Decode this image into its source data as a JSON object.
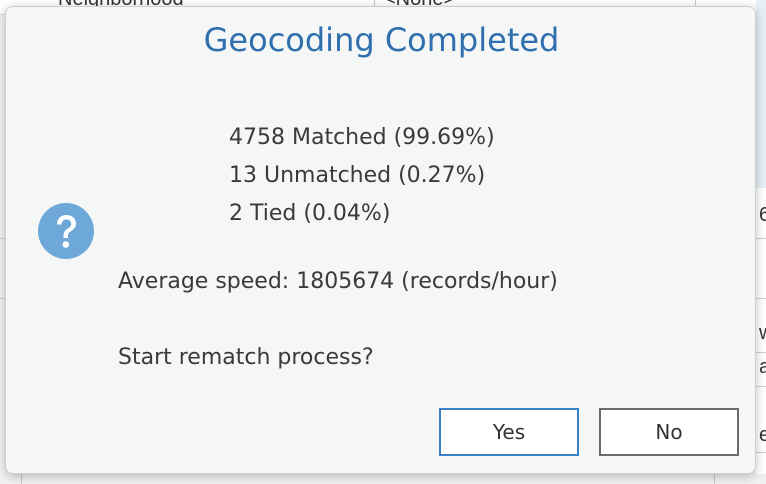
{
  "background": {
    "top_row_left_text": "Neighborhood",
    "top_row_right_text": "<None>",
    "right_edge_glyphs": [
      "6",
      "w",
      "a",
      "e"
    ]
  },
  "dialog": {
    "title": "Geocoding Completed",
    "icon": "question-icon",
    "stats": {
      "matched": "4758 Matched (99.69%)",
      "unmatched": "13 Unmatched (0.27%)",
      "tied": "2 Tied (0.04%)"
    },
    "average_speed": "Average speed: 1805674 (records/hour)",
    "prompt": "Start rematch process?",
    "buttons": {
      "yes_label": "Yes",
      "no_label": "No"
    },
    "colors": {
      "title": "#2f6fae",
      "icon": "#6ea8d8",
      "default_button_border": "#3b7fc4"
    }
  }
}
